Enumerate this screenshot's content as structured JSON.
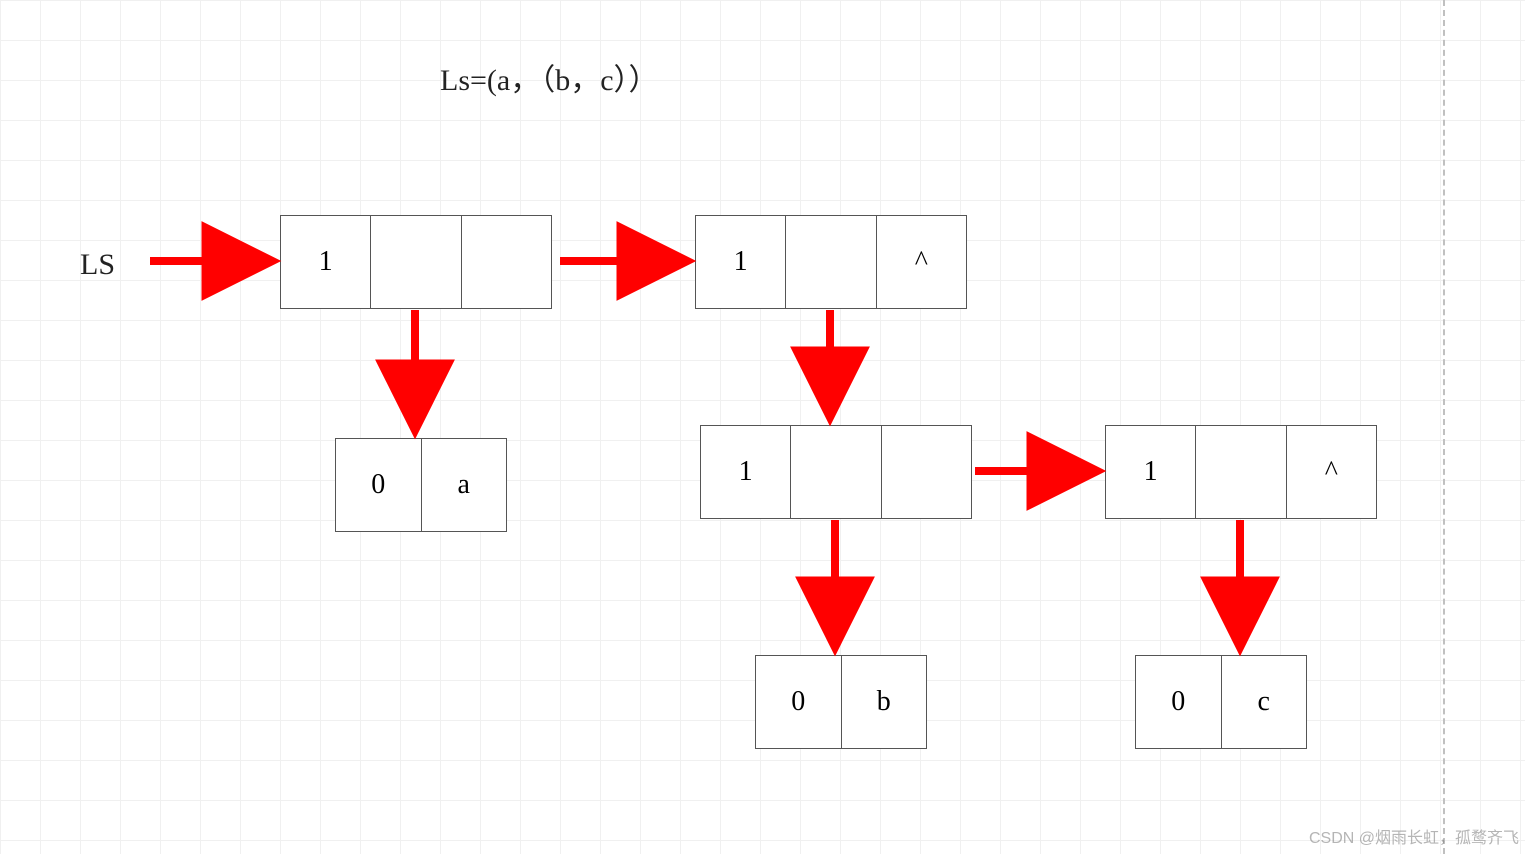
{
  "title": "Ls=(a，（b，c））",
  "label_ls": "LS",
  "watermark": "CSDN @烟雨长虹，孤鹜齐飞",
  "nodes": {
    "top1": {
      "c1": "1",
      "c2": "",
      "c3": ""
    },
    "top2": {
      "c1": "1",
      "c2": "",
      "c3": "^"
    },
    "atom_a": {
      "c1": "0",
      "c2": "a"
    },
    "mid1": {
      "c1": "1",
      "c2": "",
      "c3": ""
    },
    "mid2": {
      "c1": "1",
      "c2": "",
      "c3": "^"
    },
    "atom_b": {
      "c1": "0",
      "c2": "b"
    },
    "atom_c": {
      "c1": "0",
      "c2": "c"
    }
  }
}
